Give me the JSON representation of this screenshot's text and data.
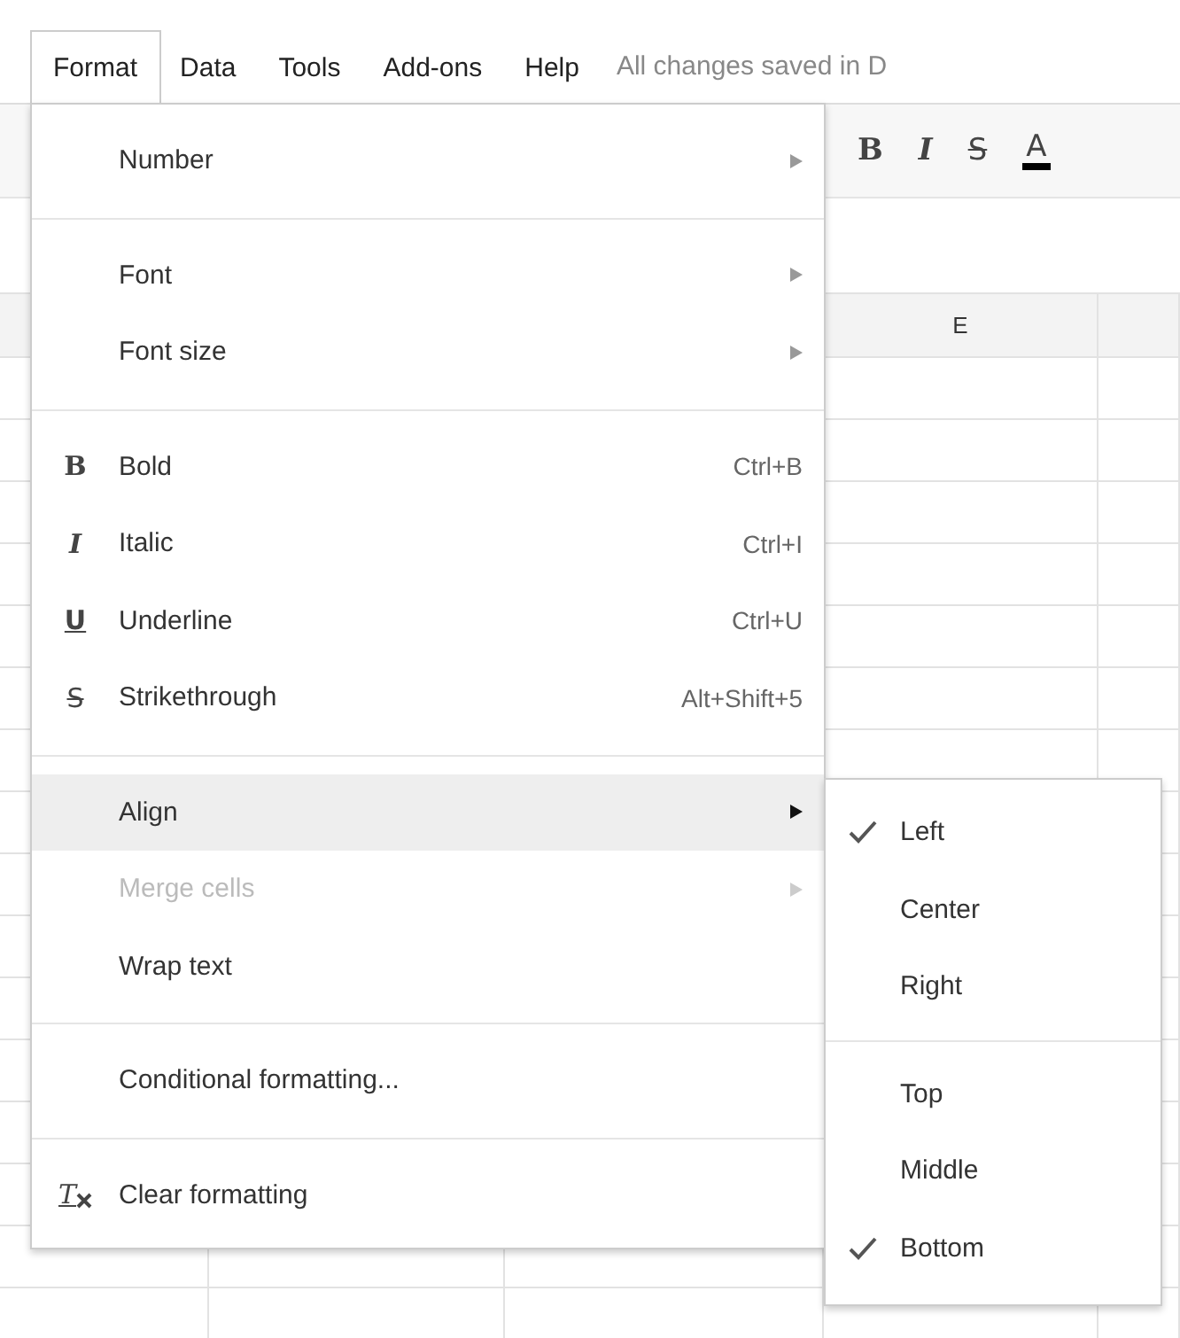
{
  "menubar": {
    "items": [
      {
        "label": "Format",
        "selected": true
      },
      {
        "label": "Data",
        "selected": false
      },
      {
        "label": "Tools",
        "selected": false
      },
      {
        "label": "Add-ons",
        "selected": false
      },
      {
        "label": "Help",
        "selected": false
      }
    ],
    "status": "All changes saved in D"
  },
  "toolbar": [
    {
      "kind": "bold",
      "glyph": "B"
    },
    {
      "kind": "italic",
      "glyph": "I"
    },
    {
      "kind": "strike",
      "glyph": "S"
    },
    {
      "kind": "color",
      "glyph": "A"
    }
  ],
  "column_header": "E",
  "format_menu": [
    {
      "kind": "submenu",
      "label": "Number",
      "selected": false,
      "disabled": false
    },
    {
      "kind": "separator"
    },
    {
      "kind": "submenu",
      "label": "Font",
      "selected": false,
      "disabled": false
    },
    {
      "kind": "submenu",
      "label": "Font size",
      "selected": false,
      "disabled": false
    },
    {
      "kind": "separator"
    },
    {
      "kind": "bold",
      "label": "Bold",
      "glyph": "B",
      "shortcut": "Ctrl+B",
      "selected": false,
      "disabled": false
    },
    {
      "kind": "italic",
      "label": "Italic",
      "glyph": "I",
      "shortcut": "Ctrl+I",
      "selected": false,
      "disabled": false
    },
    {
      "kind": "underline",
      "label": "Underline",
      "glyph": "U",
      "shortcut": "Ctrl+U",
      "selected": false,
      "disabled": false
    },
    {
      "kind": "strike",
      "label": "Strikethrough",
      "glyph": "S",
      "shortcut": "Alt+Shift+5",
      "selected": false,
      "disabled": false
    },
    {
      "kind": "separator"
    },
    {
      "kind": "submenu",
      "label": "Align",
      "selected": true,
      "disabled": false
    },
    {
      "kind": "submenu",
      "label": "Merge cells",
      "selected": false,
      "disabled": true
    },
    {
      "kind": "plain",
      "label": "Wrap text",
      "selected": false,
      "disabled": false
    },
    {
      "kind": "separator"
    },
    {
      "kind": "plain",
      "label": "Conditional formatting...",
      "selected": false,
      "disabled": false
    },
    {
      "kind": "separator"
    },
    {
      "kind": "clear",
      "label": "Clear formatting",
      "glyph": "T",
      "selected": false,
      "disabled": false
    }
  ],
  "align_submenu": [
    {
      "kind": "item",
      "label": "Left",
      "checked": true
    },
    {
      "kind": "item",
      "label": "Center",
      "checked": false
    },
    {
      "kind": "item",
      "label": "Right",
      "checked": false
    },
    {
      "kind": "separator"
    },
    {
      "kind": "item",
      "label": "Top",
      "checked": false
    },
    {
      "kind": "item",
      "label": "Middle",
      "checked": false
    },
    {
      "kind": "item",
      "label": "Bottom",
      "checked": true
    }
  ]
}
